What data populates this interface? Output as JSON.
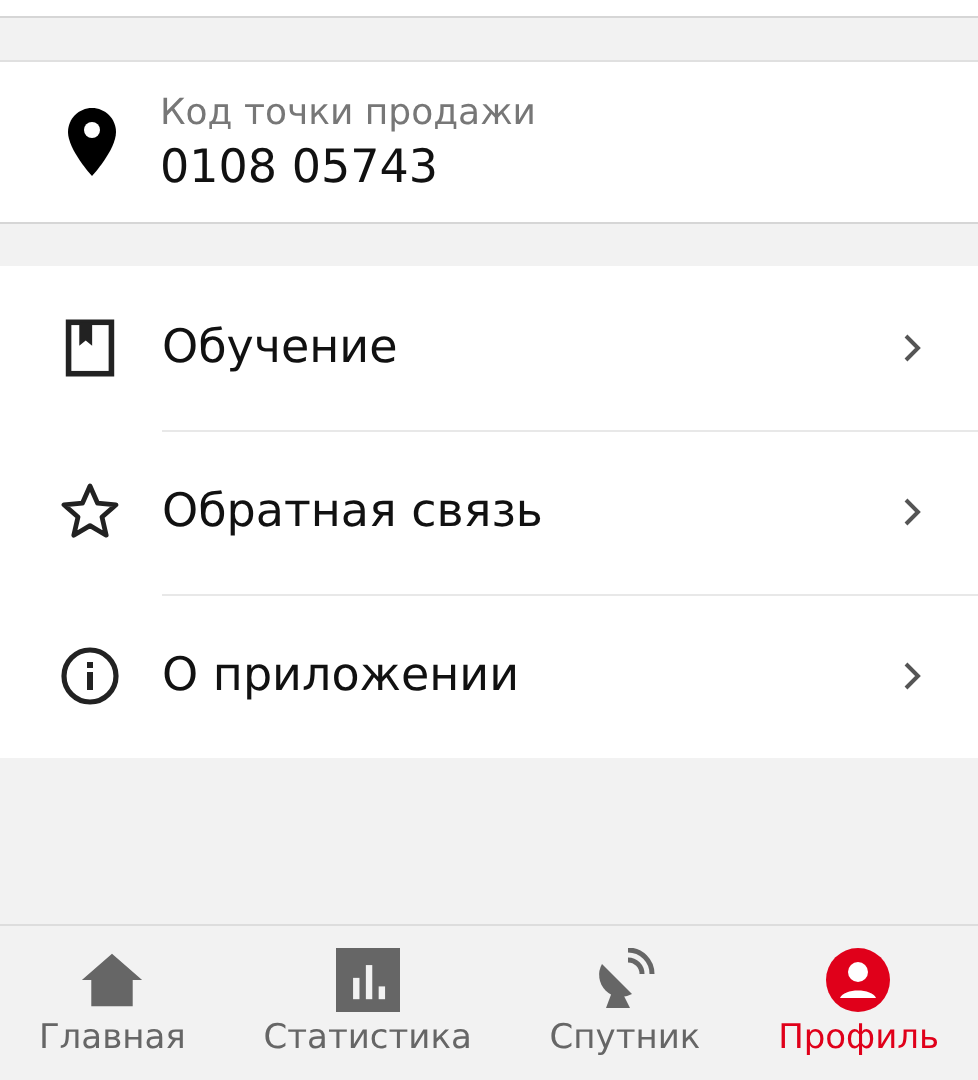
{
  "store_code": {
    "label": "Код точки продажи",
    "value": "0108 05743"
  },
  "menu": [
    {
      "kind": "book",
      "label": "Обучение"
    },
    {
      "kind": "star",
      "label": "Обратная связь"
    },
    {
      "kind": "info",
      "label": "О приложении"
    }
  ],
  "nav": [
    {
      "kind": "home",
      "label": "Главная",
      "selected": false
    },
    {
      "kind": "stats",
      "label": "Статистика",
      "selected": false
    },
    {
      "kind": "satellite",
      "label": "Спутник",
      "selected": false
    },
    {
      "kind": "profile",
      "label": "Профиль",
      "selected": true
    }
  ]
}
